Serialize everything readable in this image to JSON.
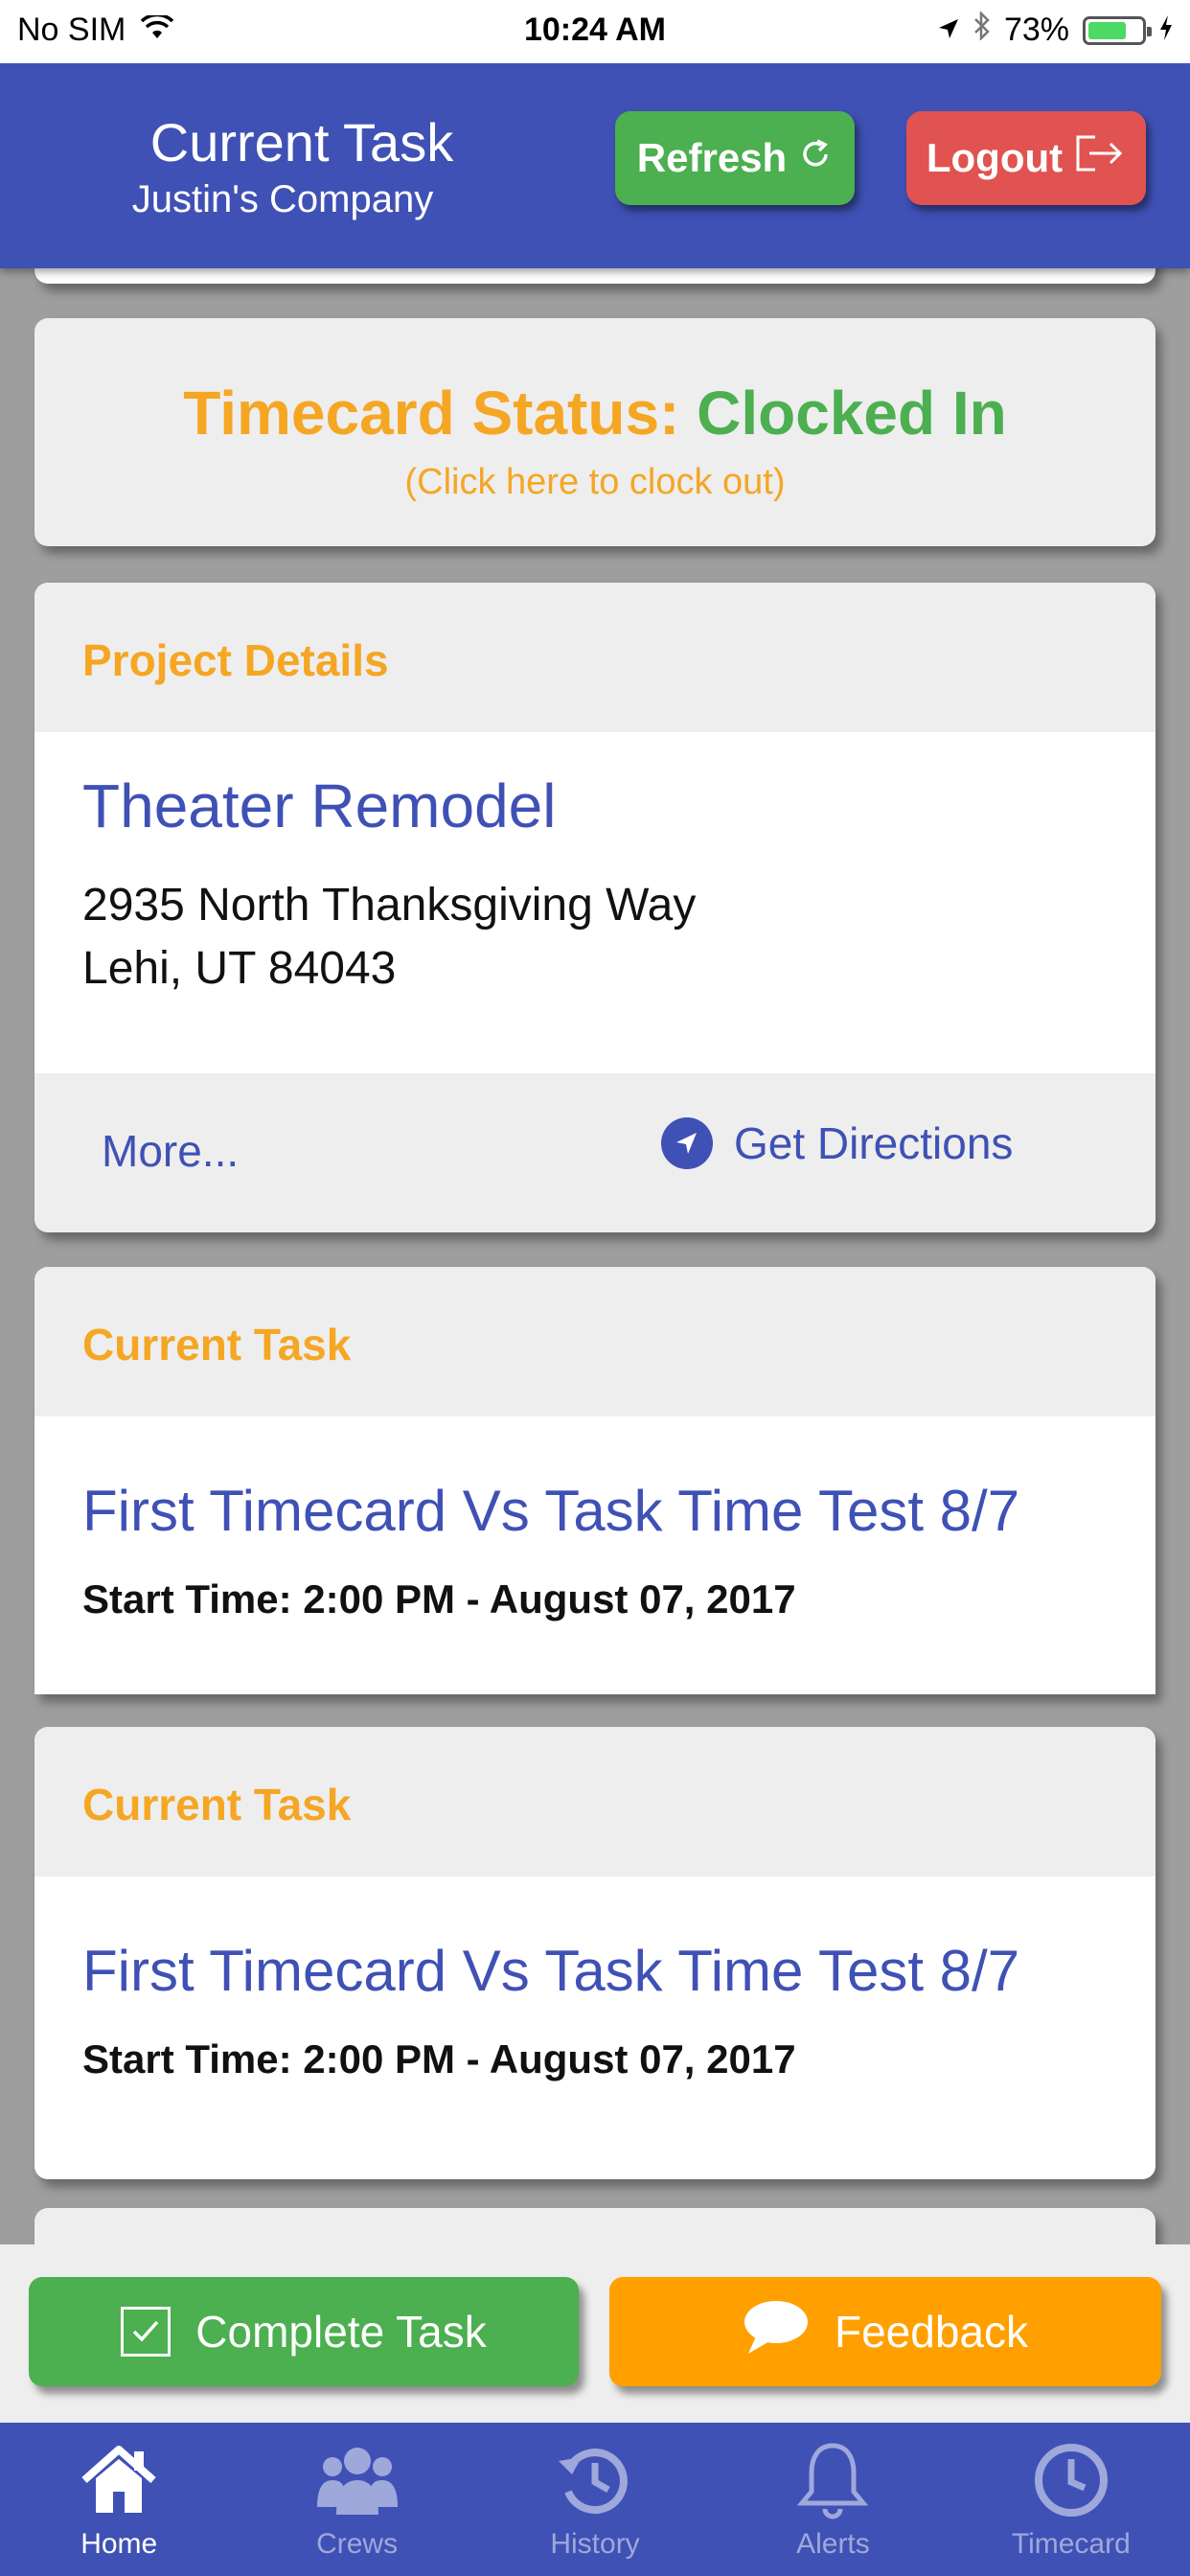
{
  "status_bar": {
    "carrier": "No SIM",
    "time": "10:24 AM",
    "battery": "73%",
    "battery_level": 0.73
  },
  "header": {
    "title": "Current Task",
    "company": "Justin's Company",
    "refresh_label": "Refresh",
    "logout_label": "Logout"
  },
  "timecard": {
    "label": "Timecard Status:",
    "value": "Clocked In",
    "hint": "(Click here to clock out)"
  },
  "project": {
    "section_title": "Project Details",
    "name": "Theater Remodel",
    "address_line1": "2935 North Thanksgiving Way",
    "address_line2": "Lehi, UT 84043",
    "more_label": "More...",
    "directions_label": "Get Directions"
  },
  "tasks": [
    {
      "section_title": "Current Task",
      "name": "First Timecard Vs Task Time Test 8/7",
      "start_time": "Start Time: 2:00 PM - August 07, 2017"
    },
    {
      "section_title": "Current Task",
      "name": "First Timecard Vs Task Time Test 8/7",
      "start_time": "Start Time: 2:00 PM - August 07, 2017"
    }
  ],
  "actions": {
    "complete_label": "Complete Task",
    "feedback_label": "Feedback"
  },
  "tabs": [
    {
      "label": "Home",
      "icon": "home-icon",
      "active": true
    },
    {
      "label": "Crews",
      "icon": "crews-icon",
      "active": false
    },
    {
      "label": "History",
      "icon": "history-icon",
      "active": false
    },
    {
      "label": "Alerts",
      "icon": "bell-icon",
      "active": false
    },
    {
      "label": "Timecard",
      "icon": "clock-icon",
      "active": false
    }
  ],
  "colors": {
    "primary": "#3f51b5",
    "accent": "#f5a623",
    "success": "#4caf50",
    "danger": "#e05350",
    "warning": "#ffa000"
  }
}
